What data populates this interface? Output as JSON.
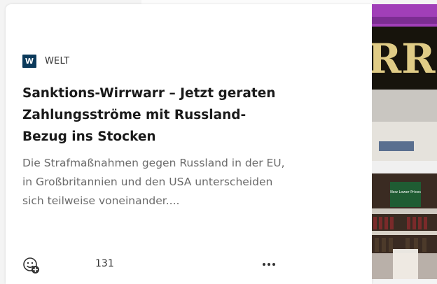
{
  "card": {
    "source": {
      "logo_letter": "W",
      "name": "WELT"
    },
    "headline": "Sanktions-Wirrwarr – Jetzt geraten Zahlungsströme mit Russland-Bezug ins Stocken",
    "snippet": "Die Strafmaßnahmen gegen Russland in der EU, in Großbritannien und den USA unterscheiden sich teilweise voneinander....",
    "reactions": {
      "count": "131",
      "icon": "add-reaction-icon"
    },
    "more_icon": "more-options-icon"
  },
  "image": {
    "sign_text": "RRI",
    "shelf_sign": "New Lower Prices",
    "colors": {
      "ceiling": "#a13fb8",
      "sign": "#17140c",
      "letters": "#e0cc86",
      "brand_blue": "#0b3a5b"
    }
  }
}
